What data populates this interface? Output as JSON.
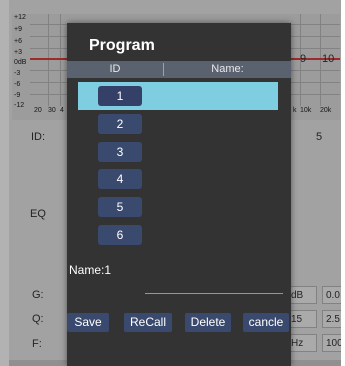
{
  "background": {
    "y_ticks": [
      "+12",
      "+9",
      "+6",
      "+3",
      "0dB",
      "-3",
      "-6",
      "-9",
      "-12"
    ],
    "x_ticks": [
      "20",
      "30",
      "4"
    ],
    "x_ticks_right": [
      "k",
      "10k",
      "20k"
    ],
    "right_values": [
      "9",
      "10"
    ],
    "labels": {
      "id": "ID:",
      "eq": "EQ",
      "g": "G:",
      "q": "Q:",
      "f": "F:",
      "id_value": "5"
    },
    "g_row": [
      "dB",
      "0.0"
    ],
    "q_row": [
      "15",
      "2.5"
    ],
    "f_row": [
      "Hz",
      "100"
    ]
  },
  "dialog": {
    "title": "Program",
    "header": {
      "id": "ID",
      "name": "Name:"
    },
    "selected_index": 0,
    "programs": [
      {
        "id": "1",
        "name": ""
      },
      {
        "id": "2",
        "name": ""
      },
      {
        "id": "3",
        "name": ""
      },
      {
        "id": "4",
        "name": ""
      },
      {
        "id": "5",
        "name": ""
      },
      {
        "id": "6",
        "name": ""
      }
    ],
    "name_label": "Name:1",
    "name_value": "",
    "buttons": {
      "save": "Save",
      "recall": "ReCall",
      "delete": "Delete",
      "cancel": "cancle"
    },
    "colors": {
      "selected_row": "#7ecde0",
      "button": "#3a4a6e",
      "dialog_bg": "#333333",
      "header_bg": "#5a6270"
    }
  }
}
